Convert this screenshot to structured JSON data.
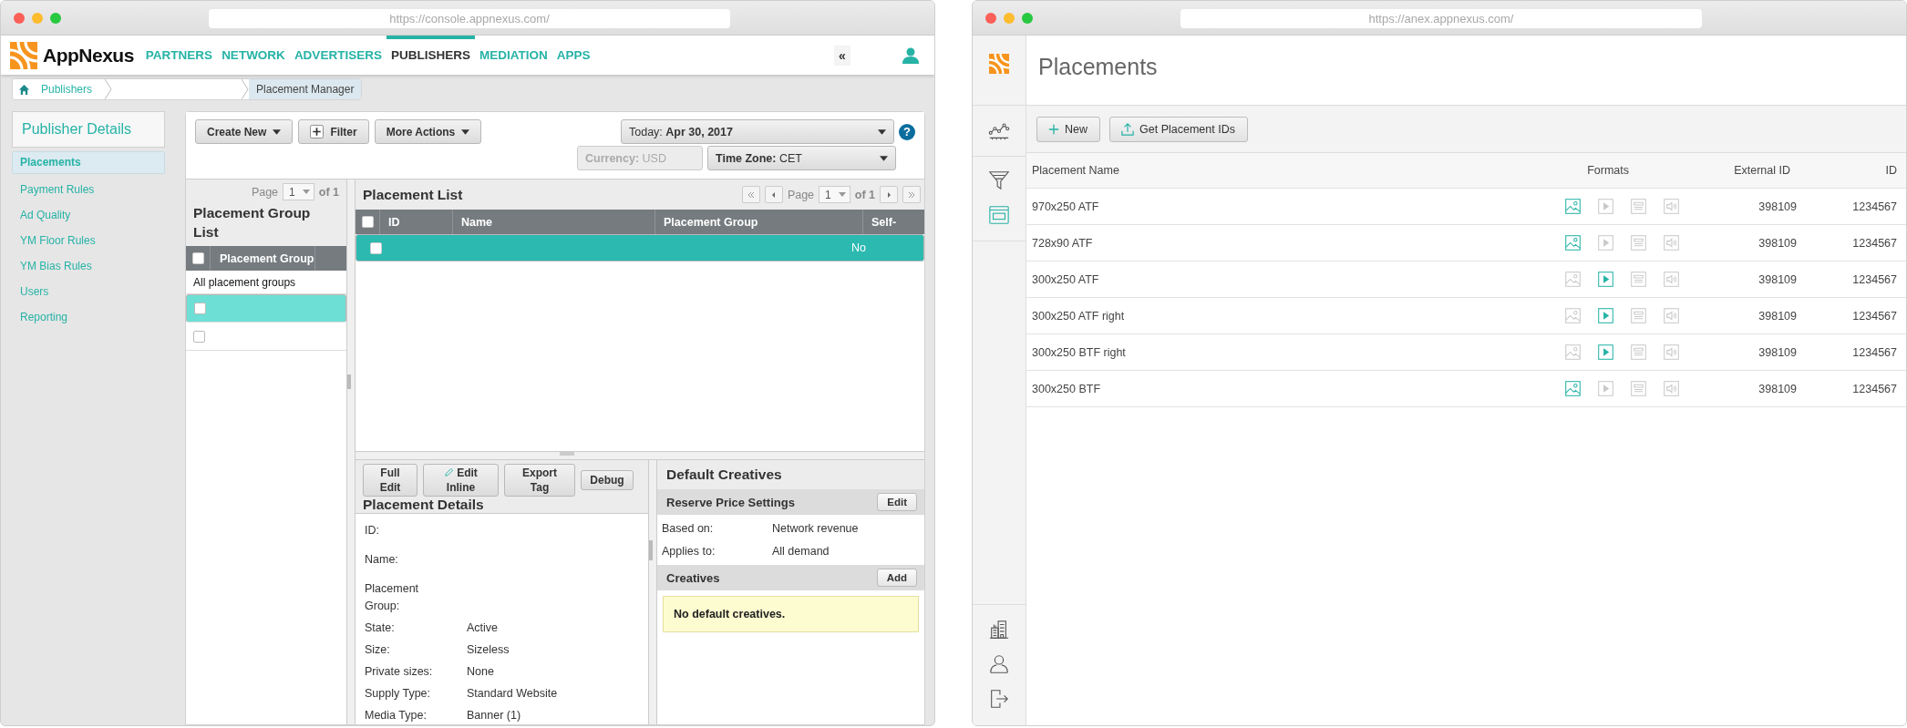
{
  "left_window": {
    "url": "https://console.appnexus.com/",
    "brand": "AppNexus",
    "nav": [
      {
        "label": "PARTNERS",
        "selected": false
      },
      {
        "label": "NETWORK",
        "selected": false
      },
      {
        "label": "ADVERTISERS",
        "selected": false
      },
      {
        "label": "PUBLISHERS",
        "selected": true
      },
      {
        "label": "MEDIATION",
        "selected": false
      },
      {
        "label": "APPS",
        "selected": false
      }
    ],
    "collapse": "«",
    "breadcrumb": {
      "parent": "Publishers",
      "current": "Placement Manager"
    },
    "sidebar": {
      "title": "Publisher Details",
      "items": [
        {
          "label": "Placements",
          "selected": true
        },
        {
          "label": "Payment Rules",
          "selected": false
        },
        {
          "label": "Ad Quality",
          "selected": false
        },
        {
          "label": "YM Floor Rules",
          "selected": false
        },
        {
          "label": "YM Bias Rules",
          "selected": false
        },
        {
          "label": "Users",
          "selected": false
        },
        {
          "label": "Reporting",
          "selected": false
        }
      ]
    },
    "toolbar": {
      "buttons": [
        {
          "label": "Create New",
          "kind": "dropdown"
        },
        {
          "label": "Filter",
          "kind": "add"
        },
        {
          "label": "More Actions",
          "kind": "dropdown"
        }
      ],
      "date": {
        "label": "Today:",
        "value": "Apr 30, 2017"
      },
      "help": "?",
      "currency": {
        "label": "Currency:",
        "value": "USD",
        "disabled": true
      },
      "timezone": {
        "label": "Time Zone:",
        "value": "CET",
        "disabled": false
      }
    },
    "group_list": {
      "pager": {
        "label": "Page",
        "value": "1",
        "total": "of 1"
      },
      "title": "Placement Group List",
      "header_checked": false,
      "column": "Placement Group",
      "rows": [
        {
          "kind": "text",
          "label": "All placement groups",
          "selected": false
        },
        {
          "kind": "check",
          "checked": false,
          "selected": true
        },
        {
          "kind": "check",
          "checked": false,
          "selected": false
        }
      ]
    },
    "placement_list": {
      "title": "Placement List",
      "pager": {
        "label": "Page",
        "value": "1",
        "total": "of 1"
      },
      "header_checked": false,
      "columns": [
        "ID",
        "Name",
        "Placement Group",
        "Self-"
      ],
      "rows": [
        {
          "checked": false,
          "selected": true,
          "column_4": "No"
        }
      ]
    },
    "details": {
      "buttons": [
        {
          "label": "Full Edit",
          "kind": "plain"
        },
        {
          "label": "Edit Inline",
          "kind": "edit"
        },
        {
          "label": "Export Tag",
          "kind": "plain"
        },
        {
          "label": "Debug",
          "kind": "plain"
        }
      ],
      "title": "Placement Details",
      "fields": [
        {
          "label": "ID:"
        },
        {
          "label": "Name:"
        },
        {
          "label": "Placement Group:"
        },
        {
          "label": "State:",
          "value": "Active"
        },
        {
          "label": "Size:",
          "value": "Sizeless"
        },
        {
          "label": "Private sizes:",
          "value": "None"
        },
        {
          "label": "Supply Type:",
          "value": "Standard Website"
        },
        {
          "label": "Media Type:",
          "value": "Banner (1)"
        }
      ]
    },
    "default_creatives": {
      "title": "Default Creatives",
      "reserve": {
        "title": "Reserve Price Settings",
        "button": "Edit",
        "rows": [
          {
            "label": "Based on:",
            "value": "Network revenue"
          },
          {
            "label": "Applies to:",
            "value": "All demand"
          }
        ]
      },
      "creatives": {
        "title": "Creatives",
        "button": "Add",
        "notice": "No default creatives."
      }
    }
  },
  "right_window": {
    "url": "https://anex.appnexus.com/",
    "rail": [
      {
        "kind": "chart",
        "selected": false
      },
      {
        "kind": "funnel",
        "selected": false
      },
      {
        "kind": "placements",
        "selected": true
      }
    ],
    "rail_bottom": [
      {
        "kind": "building"
      },
      {
        "kind": "user"
      },
      {
        "kind": "logout"
      }
    ],
    "title": "Placements",
    "buttons": [
      {
        "label": "New",
        "kind": "add"
      },
      {
        "label": "Get Placement IDs",
        "kind": "upload"
      }
    ],
    "columns": [
      "Placement Name",
      "Formats",
      "External ID",
      "ID"
    ],
    "rows": [
      {
        "name": "970x250 ATF",
        "formats": [
          {
            "kind": "image",
            "on": true
          },
          {
            "kind": "video",
            "on": false
          },
          {
            "kind": "native",
            "on": false
          },
          {
            "kind": "audio",
            "on": false
          }
        ],
        "external_id": "398109",
        "id": "1234567"
      },
      {
        "name": "728x90 ATF",
        "formats": [
          {
            "kind": "image",
            "on": true
          },
          {
            "kind": "video",
            "on": false
          },
          {
            "kind": "native",
            "on": false
          },
          {
            "kind": "audio",
            "on": false
          }
        ],
        "external_id": "398109",
        "id": "1234567"
      },
      {
        "name": "300x250 ATF",
        "formats": [
          {
            "kind": "image",
            "on": false
          },
          {
            "kind": "video",
            "on": true
          },
          {
            "kind": "native",
            "on": false
          },
          {
            "kind": "audio",
            "on": false
          }
        ],
        "external_id": "398109",
        "id": "1234567"
      },
      {
        "name": "300x250 ATF right",
        "formats": [
          {
            "kind": "image",
            "on": false
          },
          {
            "kind": "video",
            "on": true
          },
          {
            "kind": "native",
            "on": false
          },
          {
            "kind": "audio",
            "on": false
          }
        ],
        "external_id": "398109",
        "id": "1234567"
      },
      {
        "name": "300x250 BTF right",
        "formats": [
          {
            "kind": "image",
            "on": false
          },
          {
            "kind": "video",
            "on": true
          },
          {
            "kind": "native",
            "on": false
          },
          {
            "kind": "audio",
            "on": false
          }
        ],
        "external_id": "398109",
        "id": "1234567"
      },
      {
        "name": "300x250 BTF",
        "formats": [
          {
            "kind": "image",
            "on": true
          },
          {
            "kind": "video",
            "on": false
          },
          {
            "kind": "native",
            "on": false
          },
          {
            "kind": "audio",
            "on": false
          }
        ],
        "external_id": "398109",
        "id": "1234567"
      }
    ]
  }
}
